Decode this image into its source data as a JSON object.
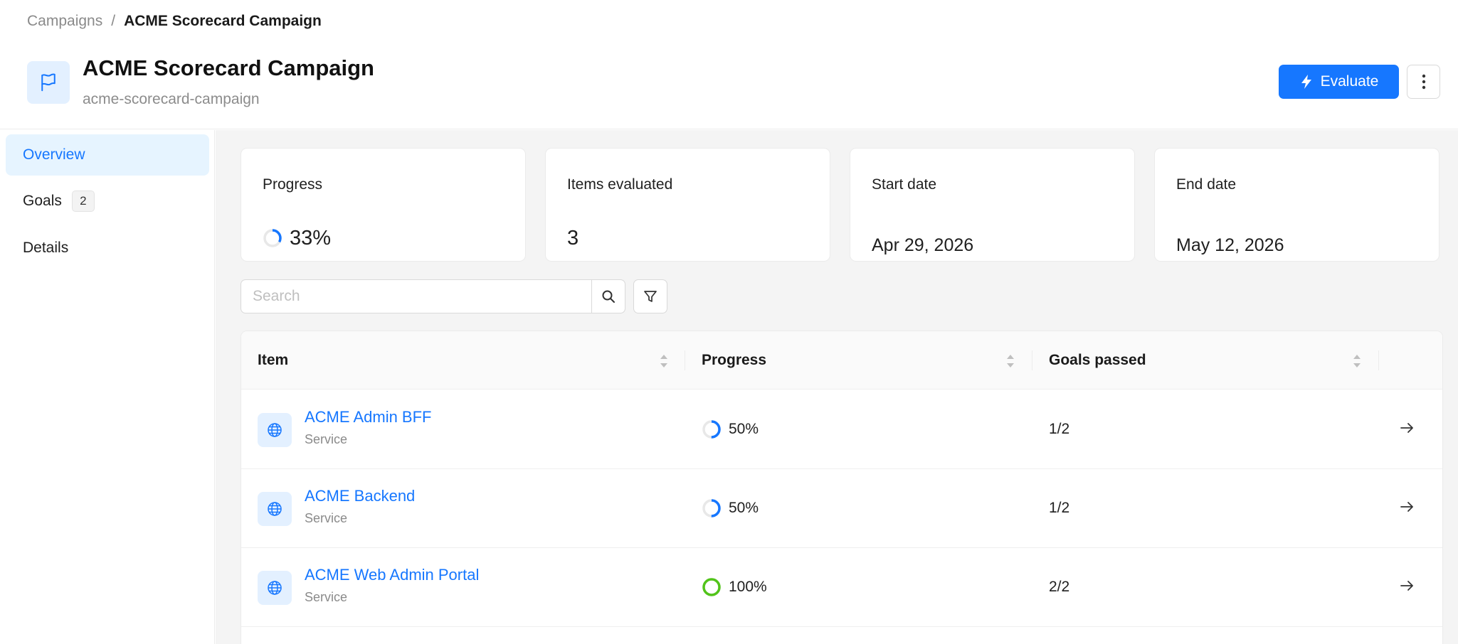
{
  "breadcrumb": {
    "parent": "Campaigns",
    "separator": "/",
    "current": "ACME Scorecard Campaign"
  },
  "header": {
    "icon": "flag-icon",
    "title": "ACME Scorecard Campaign",
    "slug": "acme-scorecard-campaign",
    "evaluate_label": "Evaluate",
    "evaluate_icon": "lightning-icon",
    "more_icon": "more-vertical-icon"
  },
  "sidebar": {
    "items": [
      {
        "label": "Overview",
        "active": true
      },
      {
        "label": "Goals",
        "badge": "2"
      },
      {
        "label": "Details"
      }
    ]
  },
  "stats": {
    "progress": {
      "label": "Progress",
      "value": "33%",
      "fraction": 0.33
    },
    "items_evaluated": {
      "label": "Items evaluated",
      "value": "3"
    },
    "start_date": {
      "label": "Start date",
      "value": "Apr 29, 2026"
    },
    "end_date": {
      "label": "End date",
      "value": "May 12, 2026"
    }
  },
  "search": {
    "placeholder": "Search",
    "value": ""
  },
  "table": {
    "columns": [
      "Item",
      "Progress",
      "Goals passed"
    ],
    "rows": [
      {
        "name": "ACME Admin BFF",
        "type": "Service",
        "icon": "globe-icon",
        "progress": "50%",
        "fraction": 0.5,
        "goals": "1/2"
      },
      {
        "name": "ACME Backend",
        "type": "Service",
        "icon": "globe-icon",
        "progress": "50%",
        "fraction": 0.5,
        "goals": "1/2"
      },
      {
        "name": "ACME Web Admin Portal",
        "type": "Service",
        "icon": "globe-icon",
        "progress": "100%",
        "fraction": 1.0,
        "goals": "2/2"
      }
    ]
  },
  "colors": {
    "accent": "#1677ff",
    "accent_light": "#e6f4ff",
    "success": "#52c41a",
    "progress_track": "#e8e8e8"
  }
}
